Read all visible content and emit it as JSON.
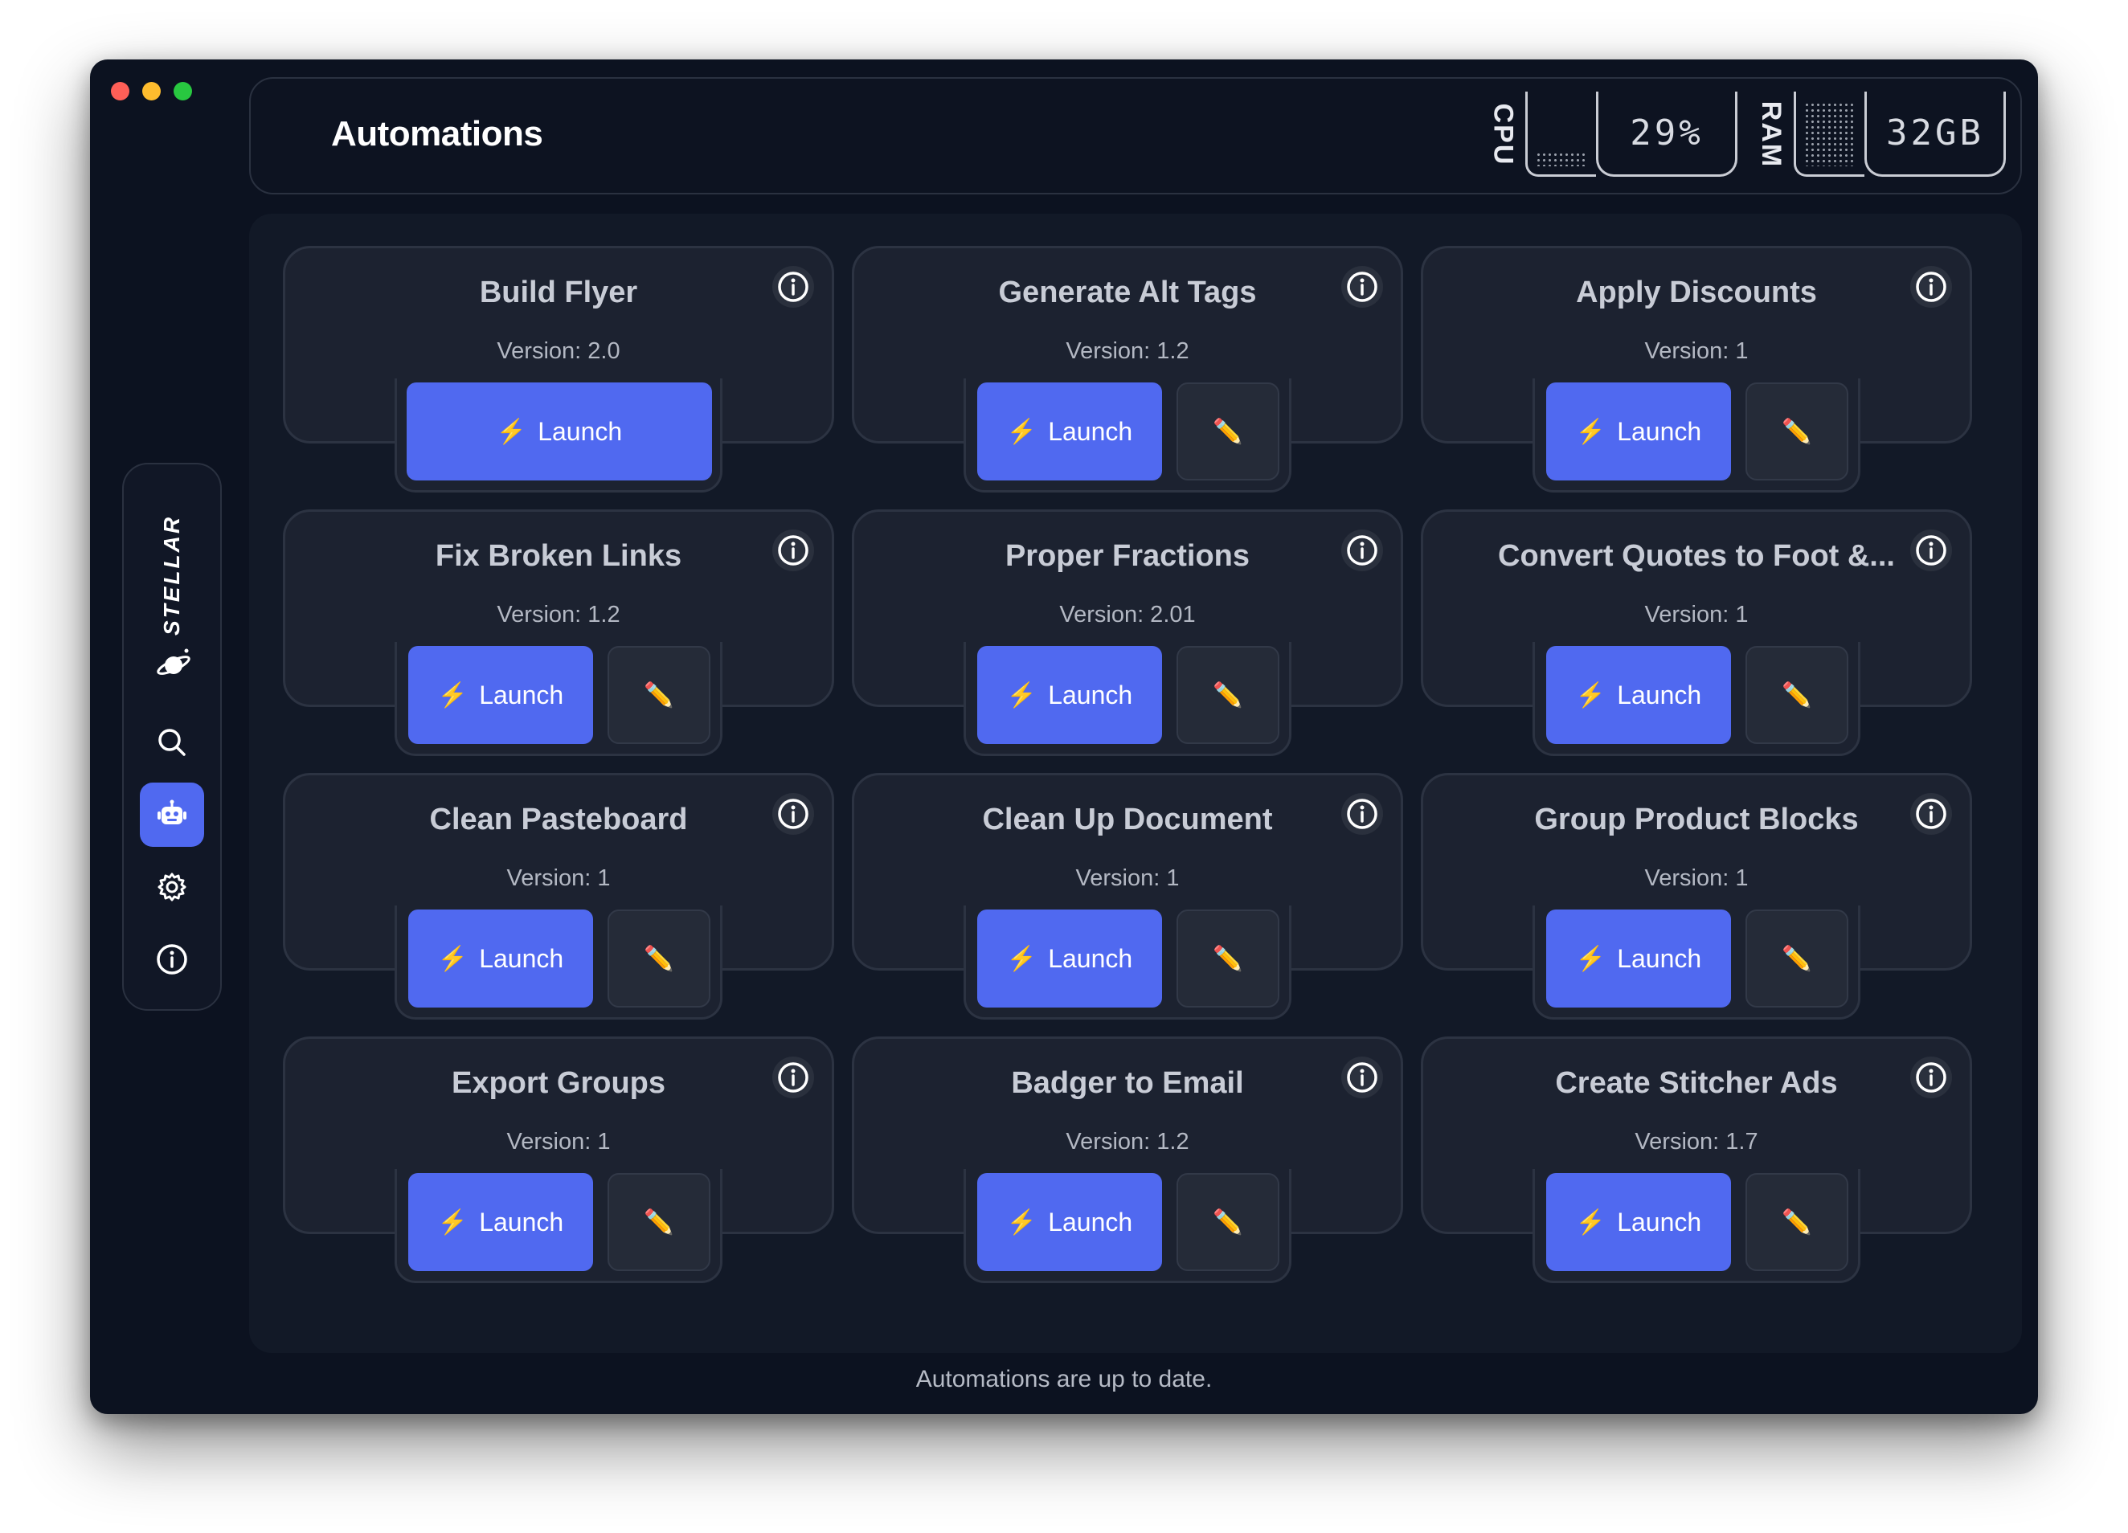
{
  "window": {
    "title": "Automations",
    "controls": [
      "close",
      "minimize",
      "zoom"
    ]
  },
  "meters": [
    {
      "label": "CPU",
      "value": "29%",
      "level": 0.22
    },
    {
      "label": "RAM",
      "value": "32GB",
      "level": 1.0
    }
  ],
  "sidebar": {
    "brand": "STELLAR",
    "items": [
      {
        "name": "search",
        "icon": "search-icon"
      },
      {
        "name": "automations",
        "icon": "robot-icon",
        "active": true
      },
      {
        "name": "settings",
        "icon": "gear-icon"
      },
      {
        "name": "info",
        "icon": "info-icon"
      }
    ]
  },
  "automations": [
    {
      "title": "Build Flyer",
      "version": "Version: 2.0",
      "launch_label": "Launch",
      "editable": false
    },
    {
      "title": "Generate Alt Tags",
      "version": "Version: 1.2",
      "launch_label": "Launch",
      "editable": true
    },
    {
      "title": "Apply Discounts",
      "version": "Version: 1",
      "launch_label": "Launch",
      "editable": true
    },
    {
      "title": "Fix Broken Links",
      "version": "Version: 1.2",
      "launch_label": "Launch",
      "editable": true
    },
    {
      "title": "Proper Fractions",
      "version": "Version: 2.01",
      "launch_label": "Launch",
      "editable": true
    },
    {
      "title": "Convert Quotes to Foot &...",
      "version": "Version: 1",
      "launch_label": "Launch",
      "editable": true
    },
    {
      "title": "Clean Pasteboard",
      "version": "Version: 1",
      "launch_label": "Launch",
      "editable": true
    },
    {
      "title": "Clean Up Document",
      "version": "Version: 1",
      "launch_label": "Launch",
      "editable": true
    },
    {
      "title": "Group Product Blocks",
      "version": "Version: 1",
      "launch_label": "Launch",
      "editable": true
    },
    {
      "title": "Export Groups",
      "version": "Version: 1",
      "launch_label": "Launch",
      "editable": true
    },
    {
      "title": "Badger to Email",
      "version": "Version: 1.2",
      "launch_label": "Launch",
      "editable": true
    },
    {
      "title": "Create Stitcher Ads",
      "version": "Version: 1.7",
      "launch_label": "Launch",
      "editable": true
    }
  ],
  "icons": {
    "launch": "⚡",
    "edit": "✏️"
  },
  "status": "Automations are up to date.",
  "colors": {
    "accent": "#5069f0",
    "background": "#0c1220",
    "card": "#1c2230",
    "text": "#c8ccd6"
  }
}
